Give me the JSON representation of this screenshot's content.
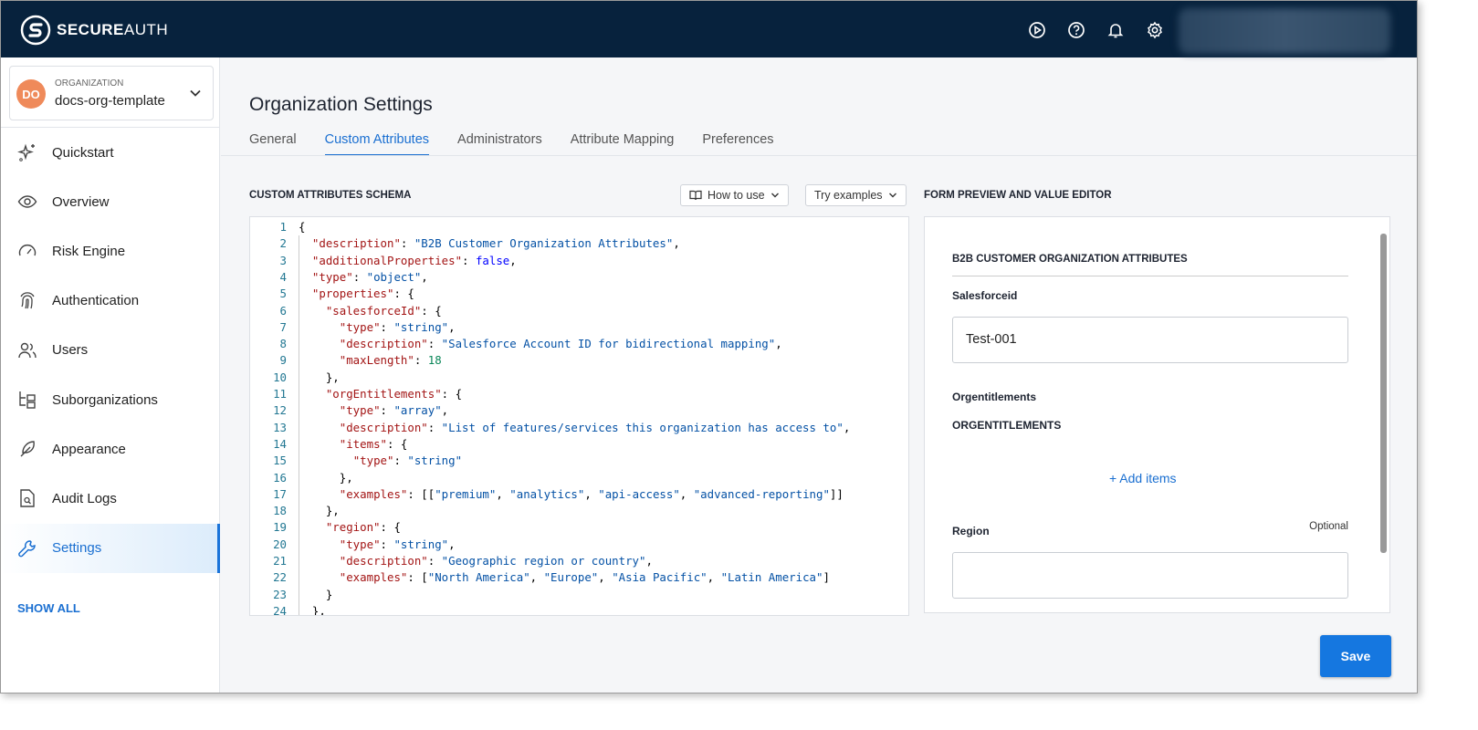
{
  "brand": {
    "name_bold": "SECURE",
    "name_light": "AUTH"
  },
  "header": {
    "icons": [
      "play-circle-icon",
      "help-icon",
      "bell-icon",
      "gear-icon"
    ]
  },
  "org": {
    "initials": "DO",
    "label": "ORGANIZATION",
    "name": "docs-org-template"
  },
  "nav": [
    {
      "label": "Quickstart"
    },
    {
      "label": "Overview"
    },
    {
      "label": "Risk Engine"
    },
    {
      "label": "Authentication"
    },
    {
      "label": "Users"
    },
    {
      "label": "Suborganizations"
    },
    {
      "label": "Appearance"
    },
    {
      "label": "Audit Logs"
    },
    {
      "label": "Settings",
      "active": true
    }
  ],
  "show_all": "SHOW ALL",
  "page": {
    "title": "Organization Settings",
    "tabs": [
      "General",
      "Custom Attributes",
      "Administrators",
      "Attribute Mapping",
      "Preferences"
    ],
    "active_tab": 1
  },
  "schema": {
    "heading": "CUSTOM ATTRIBUTES SCHEMA",
    "how_to_use": "How to use",
    "try_examples": "Try examples",
    "lines": [
      [
        [
          "p",
          "{"
        ]
      ],
      [
        [
          "p",
          "  "
        ],
        [
          "k",
          "\"description\""
        ],
        [
          "p",
          ": "
        ],
        [
          "s",
          "\"B2B Customer Organization Attributes\""
        ],
        [
          "p",
          ","
        ]
      ],
      [
        [
          "p",
          "  "
        ],
        [
          "k",
          "\"additionalProperties\""
        ],
        [
          "p",
          ": "
        ],
        [
          "b",
          "false"
        ],
        [
          "p",
          ","
        ]
      ],
      [
        [
          "p",
          "  "
        ],
        [
          "k",
          "\"type\""
        ],
        [
          "p",
          ": "
        ],
        [
          "s",
          "\"object\""
        ],
        [
          "p",
          ","
        ]
      ],
      [
        [
          "p",
          "  "
        ],
        [
          "k",
          "\"properties\""
        ],
        [
          "p",
          ": {"
        ]
      ],
      [
        [
          "p",
          "    "
        ],
        [
          "k",
          "\"salesforceId\""
        ],
        [
          "p",
          ": {"
        ]
      ],
      [
        [
          "p",
          "      "
        ],
        [
          "k",
          "\"type\""
        ],
        [
          "p",
          ": "
        ],
        [
          "s",
          "\"string\""
        ],
        [
          "p",
          ","
        ]
      ],
      [
        [
          "p",
          "      "
        ],
        [
          "k",
          "\"description\""
        ],
        [
          "p",
          ": "
        ],
        [
          "s",
          "\"Salesforce Account ID for bidirectional mapping\""
        ],
        [
          "p",
          ","
        ]
      ],
      [
        [
          "p",
          "      "
        ],
        [
          "k",
          "\"maxLength\""
        ],
        [
          "p",
          ": "
        ],
        [
          "n",
          "18"
        ]
      ],
      [
        [
          "p",
          "    },"
        ]
      ],
      [
        [
          "p",
          "    "
        ],
        [
          "k",
          "\"orgEntitlements\""
        ],
        [
          "p",
          ": {"
        ]
      ],
      [
        [
          "p",
          "      "
        ],
        [
          "k",
          "\"type\""
        ],
        [
          "p",
          ": "
        ],
        [
          "s",
          "\"array\""
        ],
        [
          "p",
          ","
        ]
      ],
      [
        [
          "p",
          "      "
        ],
        [
          "k",
          "\"description\""
        ],
        [
          "p",
          ": "
        ],
        [
          "s",
          "\"List of features/services this organization has access to\""
        ],
        [
          "p",
          ","
        ]
      ],
      [
        [
          "p",
          "      "
        ],
        [
          "k",
          "\"items\""
        ],
        [
          "p",
          ": {"
        ]
      ],
      [
        [
          "p",
          "        "
        ],
        [
          "k",
          "\"type\""
        ],
        [
          "p",
          ": "
        ],
        [
          "s",
          "\"string\""
        ]
      ],
      [
        [
          "p",
          "      },"
        ]
      ],
      [
        [
          "p",
          "      "
        ],
        [
          "k",
          "\"examples\""
        ],
        [
          "p",
          ": [["
        ],
        [
          "s",
          "\"premium\""
        ],
        [
          "p",
          ", "
        ],
        [
          "s",
          "\"analytics\""
        ],
        [
          "p",
          ", "
        ],
        [
          "s",
          "\"api-access\""
        ],
        [
          "p",
          ", "
        ],
        [
          "s",
          "\"advanced-reporting\""
        ],
        [
          "p",
          "]]"
        ]
      ],
      [
        [
          "p",
          "    },"
        ]
      ],
      [
        [
          "p",
          "    "
        ],
        [
          "k",
          "\"region\""
        ],
        [
          "p",
          ": {"
        ]
      ],
      [
        [
          "p",
          "      "
        ],
        [
          "k",
          "\"type\""
        ],
        [
          "p",
          ": "
        ],
        [
          "s",
          "\"string\""
        ],
        [
          "p",
          ","
        ]
      ],
      [
        [
          "p",
          "      "
        ],
        [
          "k",
          "\"description\""
        ],
        [
          "p",
          ": "
        ],
        [
          "s",
          "\"Geographic region or country\""
        ],
        [
          "p",
          ","
        ]
      ],
      [
        [
          "p",
          "      "
        ],
        [
          "k",
          "\"examples\""
        ],
        [
          "p",
          ": ["
        ],
        [
          "s",
          "\"North America\""
        ],
        [
          "p",
          ", "
        ],
        [
          "s",
          "\"Europe\""
        ],
        [
          "p",
          ", "
        ],
        [
          "s",
          "\"Asia Pacific\""
        ],
        [
          "p",
          ", "
        ],
        [
          "s",
          "\"Latin America\""
        ],
        [
          "p",
          "]"
        ]
      ],
      [
        [
          "p",
          "    }"
        ]
      ],
      [
        [
          "p",
          "  },"
        ]
      ]
    ]
  },
  "preview": {
    "heading": "FORM PREVIEW AND VALUE EDITOR",
    "title": "B2B CUSTOMER ORGANIZATION ATTRIBUTES",
    "salesforce_label": "Salesforceid",
    "salesforce_value": "Test-001",
    "ent_label": "Orgentitlements",
    "ent_heading": "ORGENTITLEMENTS",
    "add_items": "Add items",
    "region_label": "Region",
    "region_optional": "Optional",
    "region_value": ""
  },
  "save": "Save"
}
